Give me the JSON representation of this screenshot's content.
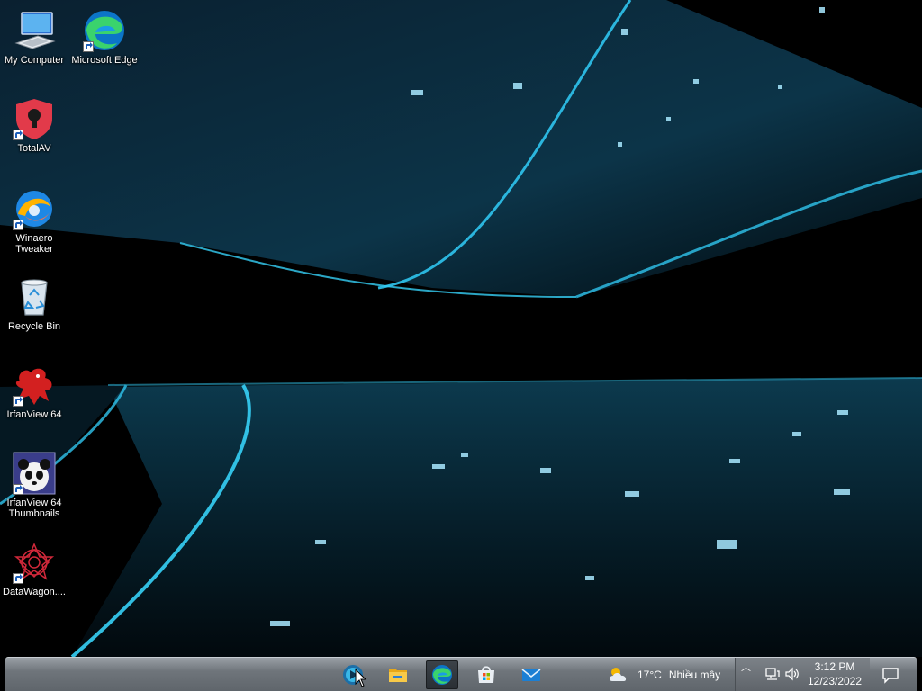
{
  "desktop": {
    "icons": [
      {
        "label": "My Computer"
      },
      {
        "label": "Microsoft Edge"
      },
      {
        "label": "TotalAV"
      },
      {
        "label": "Winaero Tweaker"
      },
      {
        "label": "Recycle Bin"
      },
      {
        "label": "IrfanView 64"
      },
      {
        "label": "IrfanView 64 Thumbnails"
      },
      {
        "label": "DataWagon...."
      }
    ]
  },
  "taskbar": {
    "apps": [
      {
        "icon": "media-player-icon"
      },
      {
        "icon": "file-explorer-icon"
      },
      {
        "icon": "edge-icon",
        "active": true
      },
      {
        "icon": "store-icon"
      },
      {
        "icon": "mail-icon"
      }
    ],
    "weather": {
      "temperature": "17°C",
      "condition": "Nhiều mây",
      "icon": "partly-cloudy-icon"
    },
    "tray": {
      "icons": [
        "show-hidden-icons-chevron",
        "network-icon",
        "volume-icon"
      ]
    },
    "clock": {
      "time": "3:12 PM",
      "date": "12/23/2022"
    },
    "notification_icon": "action-center-icon"
  },
  "colors": {
    "accent": "#1fa8d8",
    "taskbar": "#6f757b"
  }
}
